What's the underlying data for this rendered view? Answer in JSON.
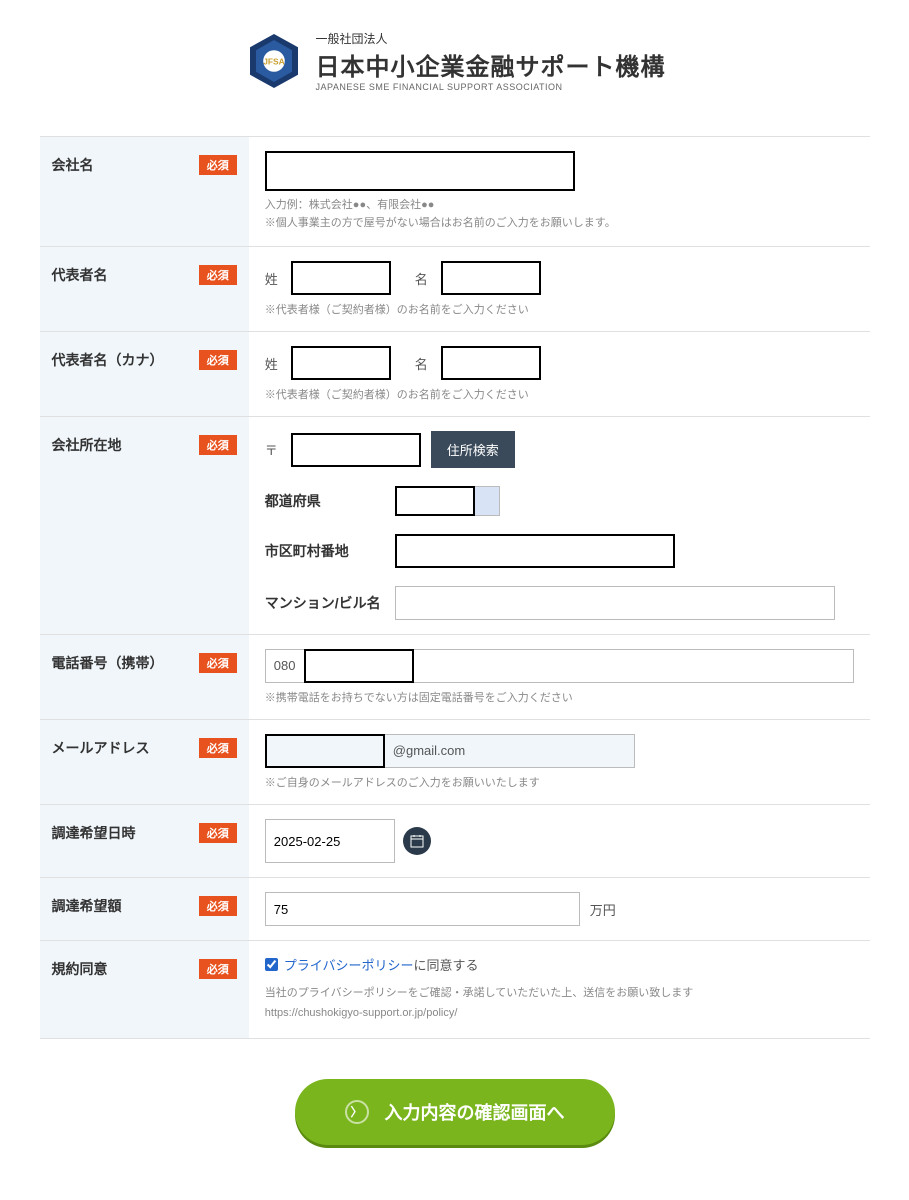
{
  "header": {
    "sub1": "一般社団法人",
    "main": "日本中小企業金融サポート機構",
    "sub2": "JAPANESE SME FINANCIAL SUPPORT ASSOCIATION",
    "logo_badge": "JFSA"
  },
  "badge": "必須",
  "fields": {
    "company": {
      "label": "会社名",
      "value": "",
      "hint1": "入力例：株式会社●●、有限会社●●",
      "hint2": "※個人事業主の方で屋号がない場合はお名前のご入力をお願いします。"
    },
    "rep_name": {
      "label": "代表者名",
      "sei_label": "姓",
      "mei_label": "名",
      "sei": "",
      "mei": "",
      "hint": "※代表者様（ご契約者様）のお名前をご入力ください"
    },
    "rep_kana": {
      "label": "代表者名（カナ）",
      "sei_label": "姓",
      "mei_label": "名",
      "sei": "",
      "mei": "",
      "hint": "※代表者様（ご契約者様）のお名前をご入力ください"
    },
    "address": {
      "label": "会社所在地",
      "zip_mark": "〒",
      "zip": "",
      "search_btn": "住所検索",
      "pref_label": "都道府県",
      "pref": "",
      "city_label": "市区町村番地",
      "city": "",
      "bldg_label": "マンション/ビル名",
      "bldg": ""
    },
    "phone": {
      "label": "電話番号（携帯）",
      "prefix": "080",
      "value": "",
      "hint": "※携帯電話をお持ちでない方は固定電話番号をご入力ください"
    },
    "email": {
      "label": "メールアドレス",
      "domain": "@gmail.com",
      "value": "",
      "hint": "※ご自身のメールアドレスのご入力をお願いいたします"
    },
    "date": {
      "label": "調達希望日時",
      "value": "2025-02-25"
    },
    "amount": {
      "label": "調達希望額",
      "value": "75",
      "unit": "万円"
    },
    "agree": {
      "label": "規約同意",
      "checkbox_label_pre": "",
      "link_text": "プライバシーポリシー",
      "checkbox_label_post": "に同意する",
      "hint1": "当社のプライバシーポリシーをご確認・承諾していただいた上、送信をお願い致します",
      "hint2": "https://chushokigyo-support.or.jp/policy/"
    }
  },
  "submit": {
    "label": "入力内容の確認画面へ"
  }
}
